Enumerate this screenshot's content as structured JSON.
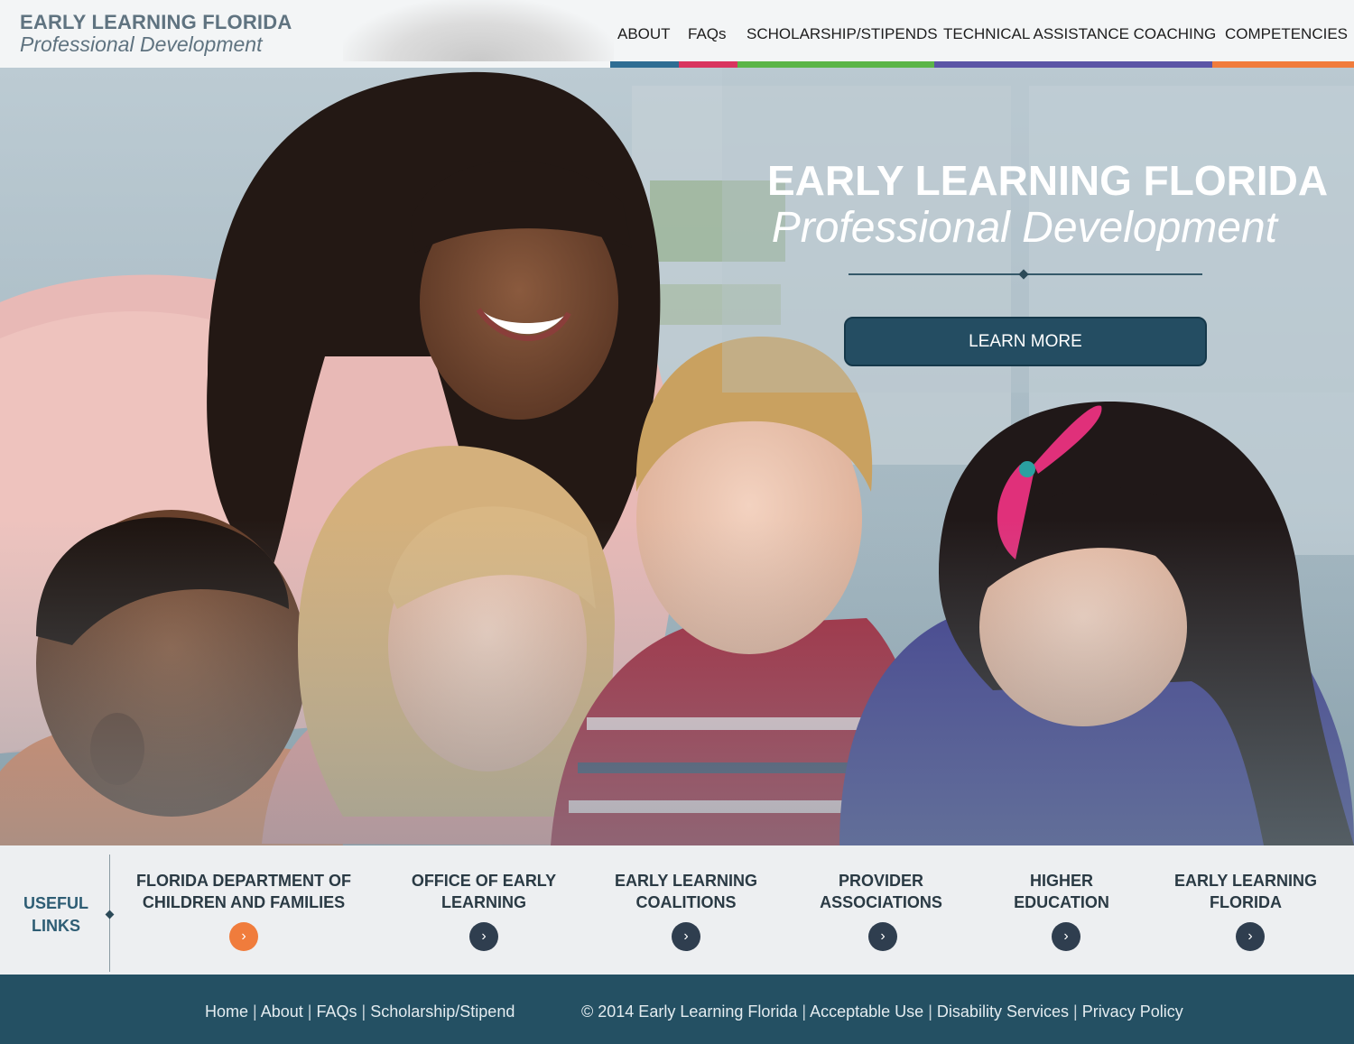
{
  "header": {
    "logo_line1": "EARLY LEARNING FLORIDA",
    "logo_line2": "Professional Development"
  },
  "nav": {
    "items": [
      {
        "label": "ABOUT",
        "color": "#2f6d93"
      },
      {
        "label": "FAQs",
        "color": "#d9355f"
      },
      {
        "label": "SCHOLARSHIP/STIPENDS",
        "color": "#5bb548"
      },
      {
        "label": "TECHNICAL ASSISTANCE COACHING",
        "color": "#5b55a6"
      },
      {
        "label": "COMPETENCIES",
        "color": "#f07c3c"
      }
    ]
  },
  "hero": {
    "title_line1": "EARLY LEARNING FLORIDA",
    "title_line2": "Professional Development",
    "cta_label": "LEARN MORE"
  },
  "useful_links": {
    "label_line1": "USEFUL",
    "label_line2": "LINKS",
    "items": [
      {
        "line1": "FLORIDA DEPARTMENT OF",
        "line2": "CHILDREN AND FAMILIES",
        "icon": "chevron-right-icon",
        "active": true
      },
      {
        "line1": "OFFICE OF EARLY",
        "line2": "LEARNING",
        "icon": "chevron-right-icon",
        "active": false
      },
      {
        "line1": "EARLY LEARNING",
        "line2": "COALITIONS",
        "icon": "chevron-right-icon",
        "active": false
      },
      {
        "line1": "PROVIDER",
        "line2": "ASSOCIATIONS",
        "icon": "chevron-right-icon",
        "active": false
      },
      {
        "line1": "HIGHER",
        "line2": "EDUCATION",
        "icon": "chevron-right-icon",
        "active": false
      },
      {
        "line1": "EARLY LEARNING",
        "line2": "FLORIDA",
        "icon": "chevron-right-icon",
        "active": false
      }
    ],
    "active_color": "#f07c3c",
    "button_color": "#2f3e4f"
  },
  "footer": {
    "left_links": [
      "Home",
      "About",
      "FAQs",
      "Scholarship/Stipend"
    ],
    "copyright": "© 2014 Early Learning Florida",
    "right_links": [
      "Acceptable Use",
      "Disability Services",
      "Privacy Policy"
    ],
    "separator": "|"
  },
  "colors": {
    "primary_dark": "#245063",
    "logo_gray": "#5f7380"
  }
}
